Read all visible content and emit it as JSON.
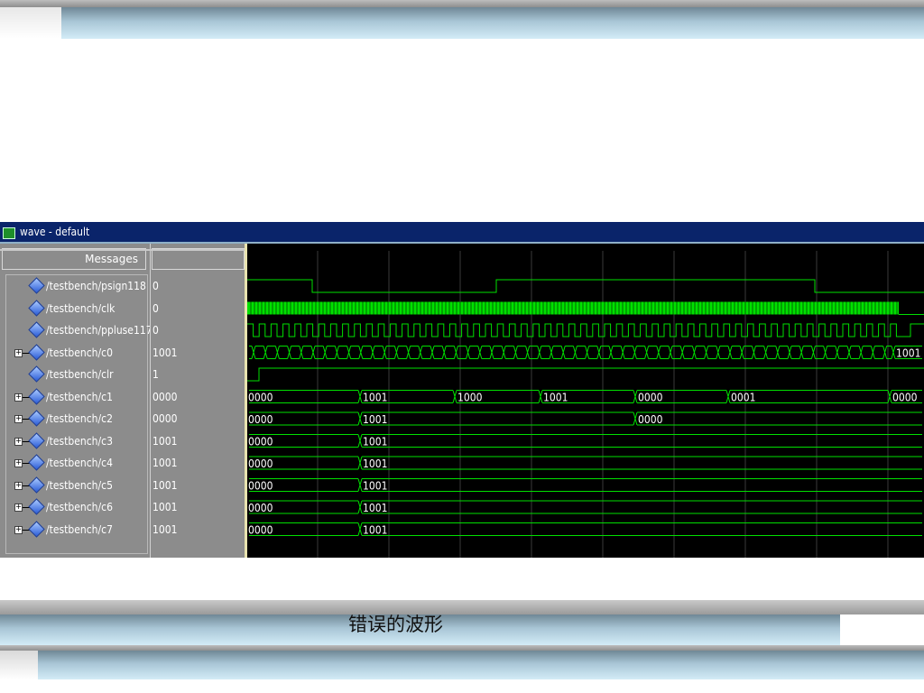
{
  "window": {
    "title": "wave - default"
  },
  "header": {
    "messages_label": "Messages"
  },
  "signals": [
    {
      "name": "/testbench/psign118",
      "value": "0",
      "expandable": false
    },
    {
      "name": "/testbench/clk",
      "value": "0",
      "expandable": false
    },
    {
      "name": "/testbench/ppluse117",
      "value": "0",
      "expandable": false
    },
    {
      "name": "/testbench/c0",
      "value": "1001",
      "expandable": true
    },
    {
      "name": "/testbench/clr",
      "value": "1",
      "expandable": false
    },
    {
      "name": "/testbench/c1",
      "value": "0000",
      "expandable": true
    },
    {
      "name": "/testbench/c2",
      "value": "0000",
      "expandable": true
    },
    {
      "name": "/testbench/c3",
      "value": "1001",
      "expandable": true
    },
    {
      "name": "/testbench/c4",
      "value": "1001",
      "expandable": true
    },
    {
      "name": "/testbench/c5",
      "value": "1001",
      "expandable": true
    },
    {
      "name": "/testbench/c6",
      "value": "1001",
      "expandable": true
    },
    {
      "name": "/testbench/c7",
      "value": "1001",
      "expandable": true
    }
  ],
  "bus_labels": {
    "c0": [
      "1001"
    ],
    "c1": [
      "0000",
      "1001",
      "1000",
      "1001",
      "0000",
      "0001",
      "0000"
    ],
    "c2": [
      "0000",
      "1001",
      "0000"
    ],
    "c3": [
      "0000",
      "1001"
    ],
    "c4": [
      "0000",
      "1001"
    ],
    "c5": [
      "0000",
      "1001"
    ],
    "c6": [
      "0000",
      "1001"
    ],
    "c7": [
      "0000",
      "1001"
    ]
  },
  "caption": "错误的波形",
  "colors": {
    "wave": "#00e000",
    "background": "#000000",
    "panel": "#8c8c8c",
    "titlebar": "#0a246a"
  }
}
